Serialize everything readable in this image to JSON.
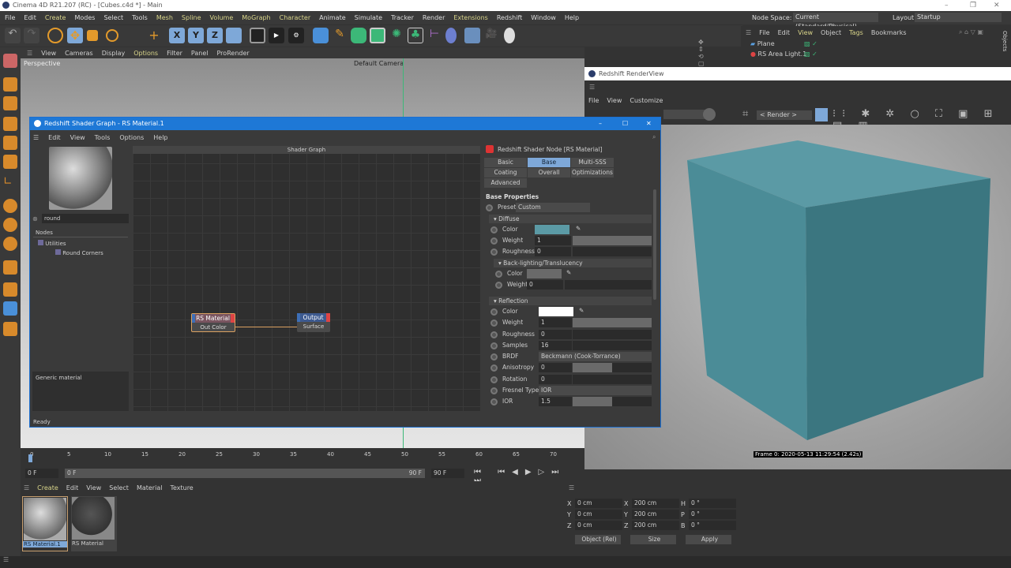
{
  "app": {
    "title": "Cinema 4D R21.207 (RC) - [Cubes.c4d *] - Main"
  },
  "menu": [
    "File",
    "Edit",
    "Create",
    "Modes",
    "Select",
    "Tools",
    "Mesh",
    "Spline",
    "Volume",
    "MoGraph",
    "Character",
    "Animate",
    "Simulate",
    "Tracker",
    "Render",
    "Extensions",
    "Redshift",
    "Window",
    "Help"
  ],
  "node_space": {
    "label": "Node Space:",
    "value": "Current (Standard/Physical)"
  },
  "layout": {
    "label": "Layout:",
    "value": "Startup"
  },
  "toolbar_axes": [
    "X",
    "Y",
    "Z"
  ],
  "viewport": {
    "menu": [
      "View",
      "Cameras",
      "Display",
      "Options",
      "Filter",
      "Panel",
      "ProRender"
    ],
    "name": "Perspective",
    "camera": "Default Camera"
  },
  "object_manager": {
    "menu": [
      "File",
      "Edit",
      "View",
      "Object",
      "Tags",
      "Bookmarks"
    ],
    "objects": [
      "Plane",
      "RS Area Light.1"
    ],
    "side_tab": "Objects"
  },
  "renderview": {
    "title": "Redshift RenderView",
    "menu": [
      "File",
      "View",
      "Customize"
    ],
    "render_select": "< Render >",
    "frame_info": "Frame 0:  2020-05-13  11:29:54  (2.42s)",
    "accent": "#5b9aa5"
  },
  "shader_graph": {
    "title": "Redshift Shader Graph - RS Material.1",
    "menu": [
      "Edit",
      "View",
      "Tools",
      "Options",
      "Help"
    ],
    "search": "round",
    "nodes_header": "Nodes",
    "tree": [
      "Utilities",
      "Round Corners"
    ],
    "description": "Generic material",
    "status": "Ready",
    "graph_title": "Shader Graph",
    "node_material": {
      "title": "RS Material",
      "port": "Out Color"
    },
    "node_output": {
      "title": "Output",
      "port": "Surface"
    }
  },
  "attributes": {
    "title": "Redshift Shader Node [RS Material]",
    "tabs": [
      "Basic",
      "Base Properties",
      "Multi-SSS",
      "Coating",
      "Overall",
      "Optimizations",
      "Advanced"
    ],
    "section": "Base Properties",
    "preset_label": "Preset",
    "preset": "Custom",
    "diffuse": {
      "label": "Diffuse",
      "color_label": "Color",
      "weight_label": "Weight",
      "weight": "1",
      "roughness_label": "Roughness",
      "roughness": "0",
      "color": "#5b9aa5"
    },
    "backlight": {
      "label": "Back-lighting/Translucency",
      "color_label": "Color",
      "weight_label": "Weight",
      "weight": "0"
    },
    "reflection": {
      "label": "Reflection",
      "color_label": "Color",
      "weight_label": "Weight",
      "weight": "1",
      "roughness_label": "Roughness",
      "roughness": "0",
      "samples_label": "Samples",
      "samples": "16",
      "brdf_label": "BRDF",
      "brdf": "Beckmann (Cook-Torrance)",
      "aniso_label": "Anisotropy",
      "aniso": "0",
      "rotation_label": "Rotation",
      "rotation": "0",
      "fresnel_label": "Fresnel Type",
      "fresnel": "IOR",
      "ior_label": "IOR",
      "ior": "1.5"
    }
  },
  "timeline": {
    "ticks": [
      "0",
      "5",
      "10",
      "15",
      "20",
      "25",
      "30",
      "35",
      "40",
      "45",
      "50",
      "55",
      "60",
      "65",
      "70"
    ],
    "start": "0 F",
    "current": "0 F",
    "end": "90 F",
    "max": "90 F"
  },
  "materials": {
    "menu": [
      "Create",
      "Edit",
      "View",
      "Select",
      "Material",
      "Texture"
    ],
    "items": [
      "RS Material.1",
      "RS Material"
    ]
  },
  "coords": {
    "pos": [
      "0 cm",
      "0 cm",
      "0 cm"
    ],
    "size": [
      "200 cm",
      "200 cm",
      "200 cm"
    ],
    "rot": [
      "0 °",
      "0 °",
      "0 °"
    ],
    "axes1": [
      "X",
      "Y",
      "Z"
    ],
    "axes3": [
      "H",
      "P",
      "B"
    ],
    "mode": "Object (Rel)",
    "size_mode": "Size",
    "apply": "Apply"
  }
}
